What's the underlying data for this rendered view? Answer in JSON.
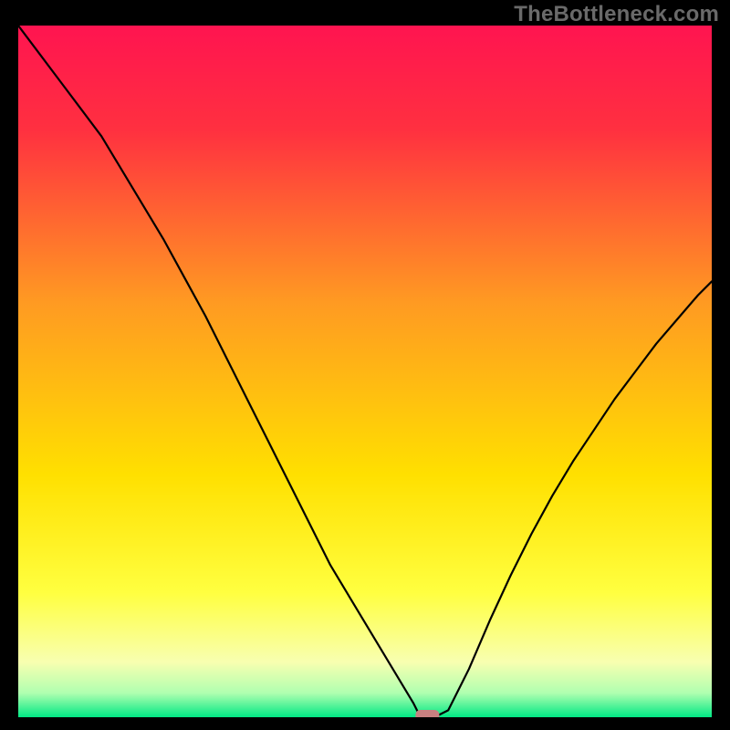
{
  "watermark": "TheBottleneck.com",
  "chart_data": {
    "type": "line",
    "title": "",
    "xlabel": "",
    "ylabel": "",
    "xlim": [
      0,
      100
    ],
    "ylim": [
      0,
      100
    ],
    "grid": false,
    "legend": false,
    "x": [
      0,
      3,
      6,
      9,
      12,
      15,
      18,
      21,
      24,
      27,
      30,
      33,
      36,
      39,
      42,
      45,
      48,
      51,
      54,
      57,
      58,
      60,
      62,
      65,
      68,
      71,
      74,
      77,
      80,
      83,
      86,
      89,
      92,
      95,
      98,
      100
    ],
    "values": [
      100,
      96,
      92,
      88,
      84,
      79,
      74,
      69,
      63.5,
      58,
      52,
      46,
      40,
      34,
      28,
      22,
      17,
      12,
      7,
      2,
      0,
      0,
      1,
      7,
      14,
      20.5,
      26.5,
      32,
      37,
      41.5,
      46,
      50,
      54,
      57.5,
      61,
      63
    ],
    "marker": {
      "x": 59,
      "y": 0,
      "color": "#c88080"
    },
    "background_gradient": {
      "stops": [
        {
          "offset": 0.0,
          "color": "#ff1450"
        },
        {
          "offset": 0.15,
          "color": "#ff3040"
        },
        {
          "offset": 0.4,
          "color": "#ff9a22"
        },
        {
          "offset": 0.65,
          "color": "#ffe000"
        },
        {
          "offset": 0.82,
          "color": "#ffff40"
        },
        {
          "offset": 0.92,
          "color": "#f8ffb0"
        },
        {
          "offset": 0.965,
          "color": "#b0ffb0"
        },
        {
          "offset": 1.0,
          "color": "#00e884"
        }
      ]
    }
  }
}
